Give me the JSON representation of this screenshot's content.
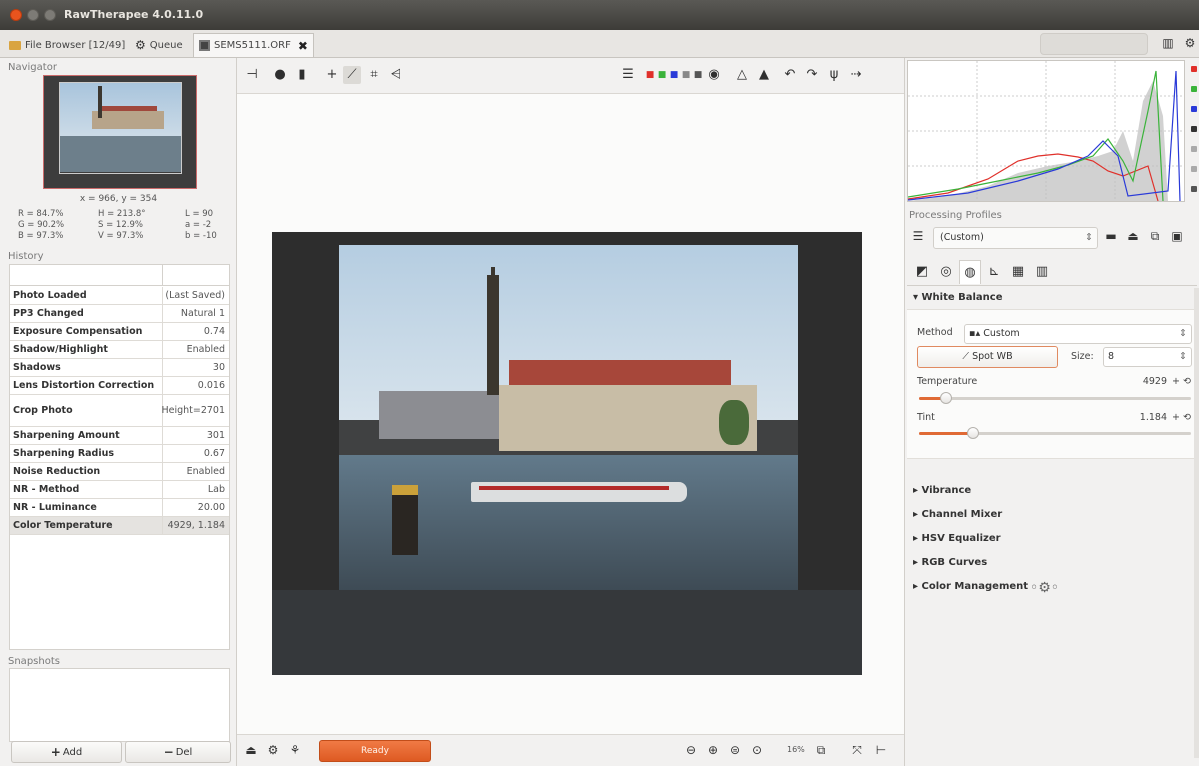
{
  "window": {
    "title": "RawTherapee 4.0.11.0"
  },
  "tabs": [
    {
      "label": "File Browser [12/49]"
    },
    {
      "label": "Queue"
    },
    {
      "label": "SEMS5111.ORF",
      "close": "✖"
    }
  ],
  "navigator": {
    "label": "Navigator",
    "coord": "x = 966, y = 354",
    "pixel_col1": [
      "R = 84.7%",
      "G = 90.2%",
      "B = 97.3%"
    ],
    "pixel_col2": [
      "H = 213.8°",
      "S = 12.9%",
      "V = 97.3%"
    ],
    "pixel_col3": [
      "L = 90",
      "a = -2",
      "b = -10"
    ]
  },
  "history": {
    "label": "History",
    "rows": [
      {
        "key": "Photo Loaded",
        "value": "(Last Saved)"
      },
      {
        "key": "PP3 Changed",
        "value": "Natural 1"
      },
      {
        "key": "Exposure Compensation",
        "value": "0.74"
      },
      {
        "key": "Shadow/Highlight",
        "value": "Enabled"
      },
      {
        "key": "Shadows",
        "value": "30"
      },
      {
        "key": "Lens Distortion Correction",
        "value": "0.016"
      },
      {
        "key": "Crop Photo",
        "value": "Height=2701"
      },
      {
        "key": "Sharpening Amount",
        "value": "301"
      },
      {
        "key": "Sharpening Radius",
        "value": "0.67"
      },
      {
        "key": "Noise Reduction",
        "value": "Enabled"
      },
      {
        "key": "NR - Method",
        "value": "Lab"
      },
      {
        "key": "NR - Luminance",
        "value": "20.00"
      },
      {
        "key": "Color Temperature",
        "value": "4929, 1.184"
      }
    ]
  },
  "snapshots": {
    "label": "Snapshots",
    "add_label": "Add",
    "del_label": "Del"
  },
  "status": {
    "ready_label": "Ready",
    "zoom": "16%"
  },
  "processing_profiles": {
    "label": "Processing Profiles",
    "value": "(Custom)"
  },
  "white_balance": {
    "header": "White Balance",
    "method_label": "Method",
    "method_value": "Custom",
    "spot_wb_label": "Spot WB",
    "size_label": "Size:",
    "size_value": "8",
    "temperature_label": "Temperature",
    "temperature_value": "4929",
    "temperature_fraction": 0.1,
    "tint_label": "Tint",
    "tint_value": "1.184",
    "tint_fraction": 0.2
  },
  "collapsed_tools": [
    {
      "label": "Vibrance"
    },
    {
      "label": "Channel Mixer"
    },
    {
      "label": "HSV Equalizer"
    },
    {
      "label": "RGB Curves"
    },
    {
      "label": "Color Management"
    }
  ],
  "colors": {
    "accent": "#e06a35",
    "hist_red": "#e0302a",
    "hist_green": "#3ab33a",
    "hist_blue": "#2a3ad8"
  }
}
